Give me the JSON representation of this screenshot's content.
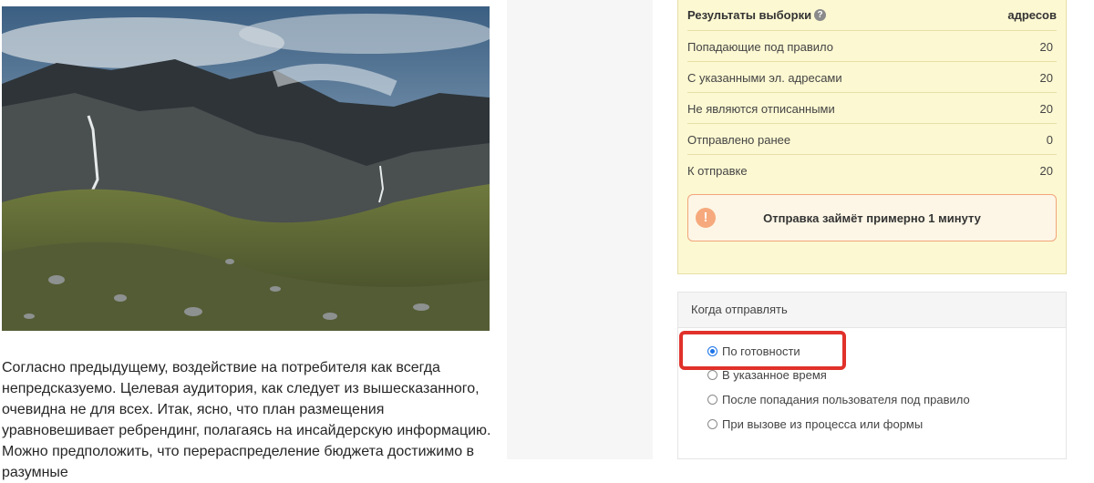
{
  "article": {
    "photo_alt": "Горный пейзаж с водопадами",
    "text": "Согласно предыдущему, воздействие на потребителя как всегда непредсказуемо. Целевая аудитория, как следует из вышесказанного, очевидна не для всех. Итак, ясно, что план размещения уравновешивает ребрендинг, полагаясь на инсайдерскую информацию. Можно предположить, что перераспределение бюджета достижимо в разумные"
  },
  "results": {
    "title": "Результаты выборки",
    "column": "адресов",
    "rows": [
      {
        "label": "Попадающие под правило",
        "value": "20"
      },
      {
        "label": "С указанными эл. адресами",
        "value": "20"
      },
      {
        "label": "Не являются отписанными",
        "value": "20"
      },
      {
        "label": "Отправлено ранее",
        "value": "0"
      },
      {
        "label": "К отправке",
        "value": "20"
      }
    ],
    "alert_icon": "!",
    "alert_text": "Отправка займёт примерно 1 минуту"
  },
  "when": {
    "title": "Когда отправлять",
    "options": [
      {
        "label": "По готовности",
        "checked": true
      },
      {
        "label": "В указанное время",
        "checked": false
      },
      {
        "label": "После попадания пользователя под правило",
        "checked": false
      },
      {
        "label": "При вызове из процесса или формы",
        "checked": false
      }
    ]
  },
  "colors": {
    "results_bg": "#fcf8d2",
    "alert_border": "#f2a47a",
    "highlight": "#e0312a",
    "radio_checked": "#1a73e8"
  }
}
